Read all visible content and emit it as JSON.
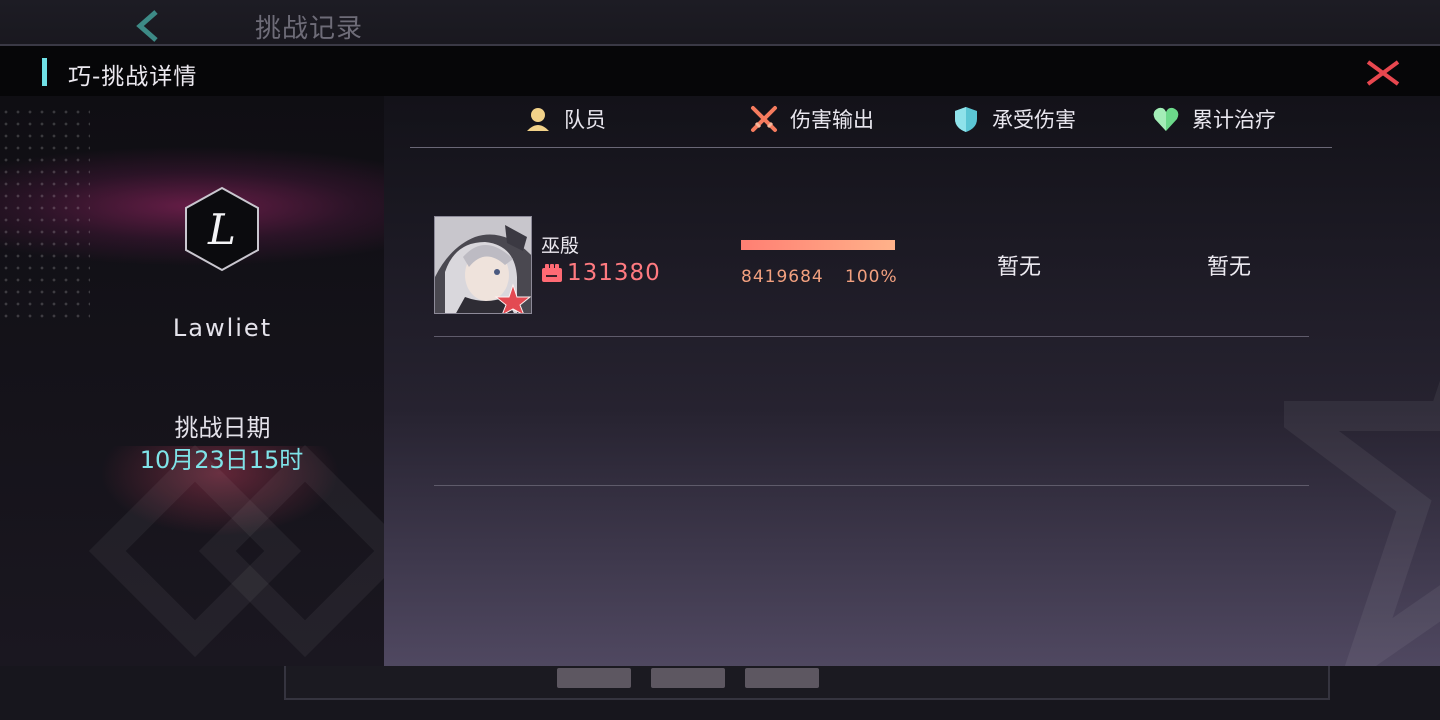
{
  "background": {
    "title": "挑战记录",
    "back_icon": "chevron-left-icon"
  },
  "dialog": {
    "title": "巧-挑战详情",
    "close_icon": "close-icon",
    "colors": {
      "accent": "#6fe0e6",
      "close": "#e8474f",
      "power": "#ff7a80",
      "damage": "#f2a07f"
    }
  },
  "profile": {
    "avatar_letter": "L",
    "name": "Lawliet",
    "date_label": "挑战日期",
    "date_value": "10月23日15时"
  },
  "columns": {
    "member": {
      "label": "队员",
      "icon": "person-icon"
    },
    "damage": {
      "label": "伤害输出",
      "icon": "crossed-swords-icon"
    },
    "taken": {
      "label": "承受伤害",
      "icon": "shield-icon"
    },
    "healing": {
      "label": "累计治疗",
      "icon": "heart-icon"
    }
  },
  "rows": [
    {
      "name": "巫殷",
      "power": "131380",
      "damage": "8419684",
      "damage_pct": "100%",
      "damage_fill": 1.0,
      "taken": "暂无",
      "healing": "暂无"
    }
  ]
}
